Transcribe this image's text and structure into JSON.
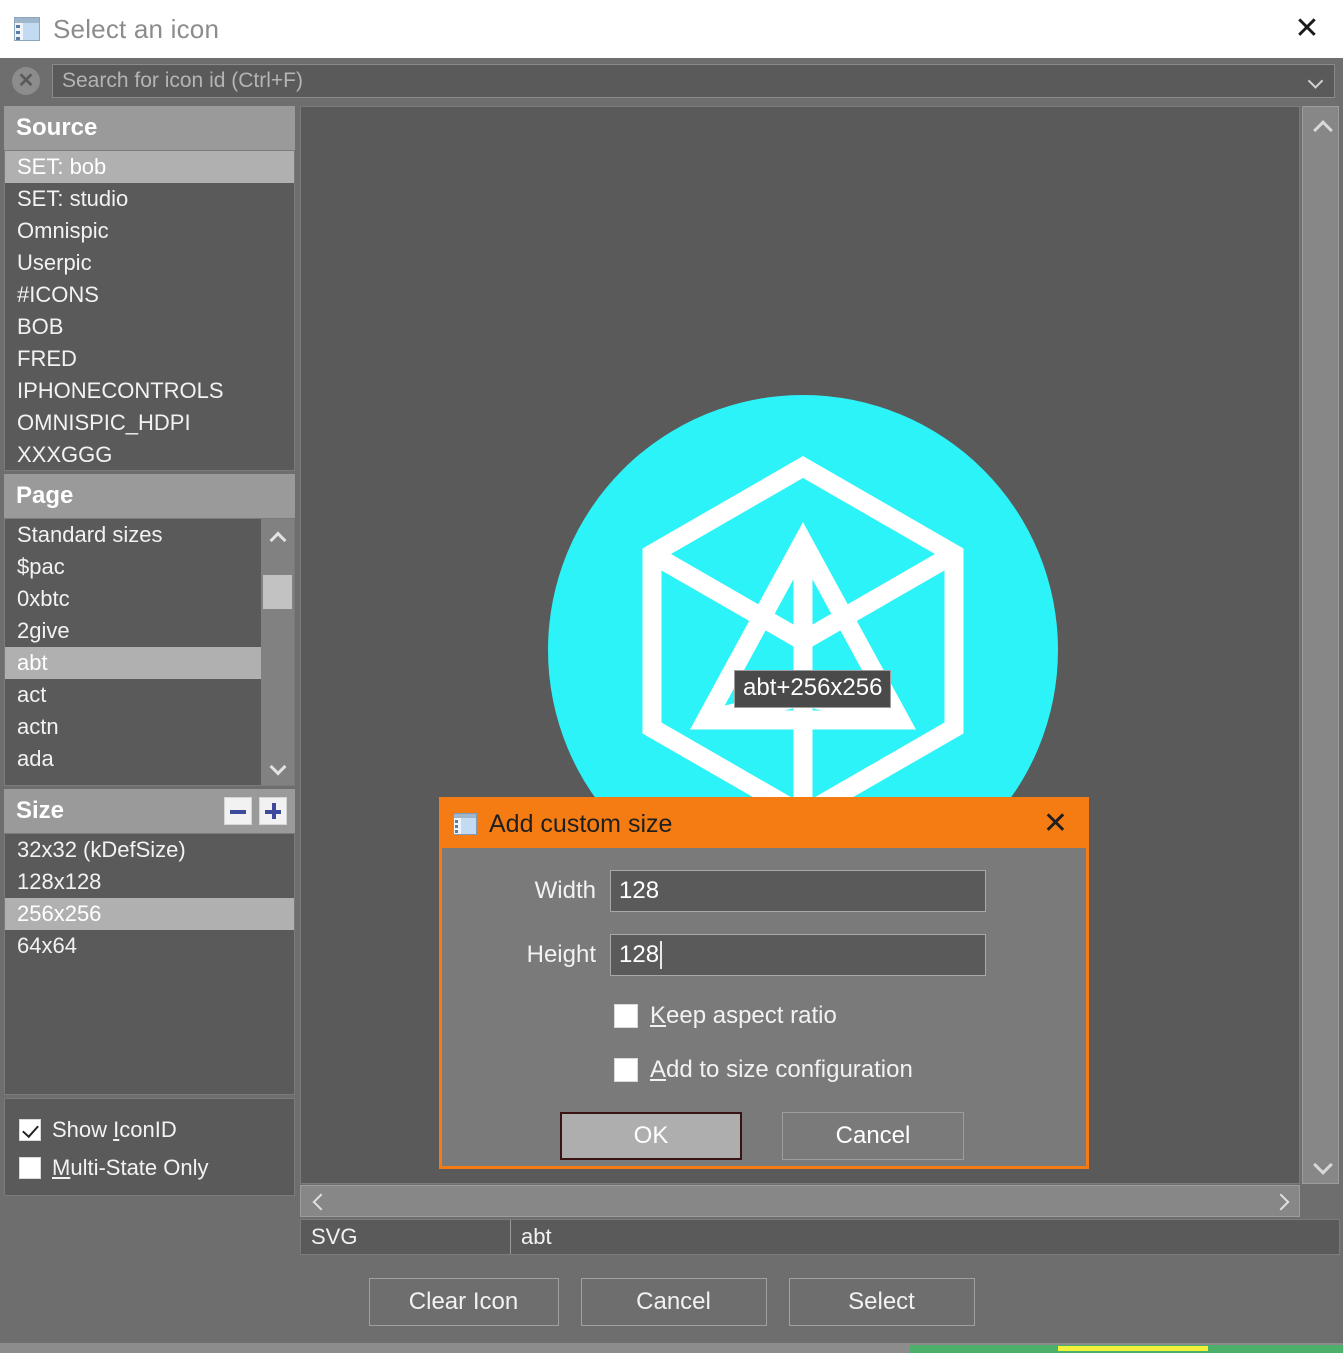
{
  "window": {
    "title": "Select an icon",
    "title_icon": "window-form-icon",
    "close_label": "✕"
  },
  "search": {
    "placeholder": "Search for icon id (Ctrl+F)",
    "value": "",
    "clear_icon": "clear-circle-icon",
    "dropdown_icon": "chevron-down-icon"
  },
  "source": {
    "header": "Source",
    "items": [
      {
        "label": "SET: bob",
        "selected": true
      },
      {
        "label": "SET: studio",
        "selected": false
      },
      {
        "label": "Omnispic",
        "selected": false
      },
      {
        "label": "Userpic",
        "selected": false
      },
      {
        "label": "#ICONS",
        "selected": false
      },
      {
        "label": "BOB",
        "selected": false
      },
      {
        "label": "FRED",
        "selected": false
      },
      {
        "label": "IPHONECONTROLS",
        "selected": false
      },
      {
        "label": "OMNISPIC_HDPI",
        "selected": false
      },
      {
        "label": "XXXGGG",
        "selected": false
      }
    ]
  },
  "page": {
    "header": "Page",
    "items": [
      {
        "label": "Standard sizes",
        "selected": false
      },
      {
        "label": "$pac",
        "selected": false
      },
      {
        "label": "0xbtc",
        "selected": false
      },
      {
        "label": "2give",
        "selected": false
      },
      {
        "label": "abt",
        "selected": true
      },
      {
        "label": "act",
        "selected": false
      },
      {
        "label": "actn",
        "selected": false
      },
      {
        "label": "ada",
        "selected": false
      }
    ],
    "scroll_up_icon": "chevron-up-icon",
    "scroll_down_icon": "chevron-down-icon"
  },
  "size": {
    "header": "Size",
    "remove_icon": "minus-icon",
    "add_icon": "plus-icon",
    "items": [
      {
        "label": "32x32 (kDefSize)",
        "selected": false
      },
      {
        "label": "128x128",
        "selected": false
      },
      {
        "label": "256x256",
        "selected": true
      },
      {
        "label": "64x64",
        "selected": false
      }
    ]
  },
  "options": {
    "show_icon_id": {
      "label_pre": "Show ",
      "accel": "I",
      "label_post": "conID",
      "checked": true
    },
    "multi_state_only": {
      "label_pre": "",
      "accel": "M",
      "label_post": "ulti-State Only",
      "checked": false
    }
  },
  "preview": {
    "icon_label": "abt+256x256",
    "circle_color": "#2bf3f7",
    "glyph_color": "#ffffff",
    "scroll_up_icon": "chevron-up-icon",
    "scroll_down_icon": "chevron-down-icon",
    "hscroll_left_icon": "chevron-left-icon",
    "hscroll_right_icon": "chevron-right-icon"
  },
  "status": {
    "format": "SVG",
    "name": "abt"
  },
  "footer": {
    "clear_icon": "Clear Icon",
    "cancel": "Cancel",
    "select": "Select"
  },
  "dialog": {
    "title": "Add custom size",
    "title_icon": "window-form-icon",
    "close_label": "✕",
    "accent_color": "#f57c12",
    "width_label": "Width",
    "width_value": "128",
    "height_label": "Height",
    "height_value": "128",
    "keep_aspect": {
      "accel": "K",
      "label_post": "eep aspect ratio",
      "checked": false
    },
    "add_to_config": {
      "accel": "A",
      "label_post": "dd to size configuration",
      "checked": false
    },
    "ok": "OK",
    "cancel": "Cancel"
  }
}
